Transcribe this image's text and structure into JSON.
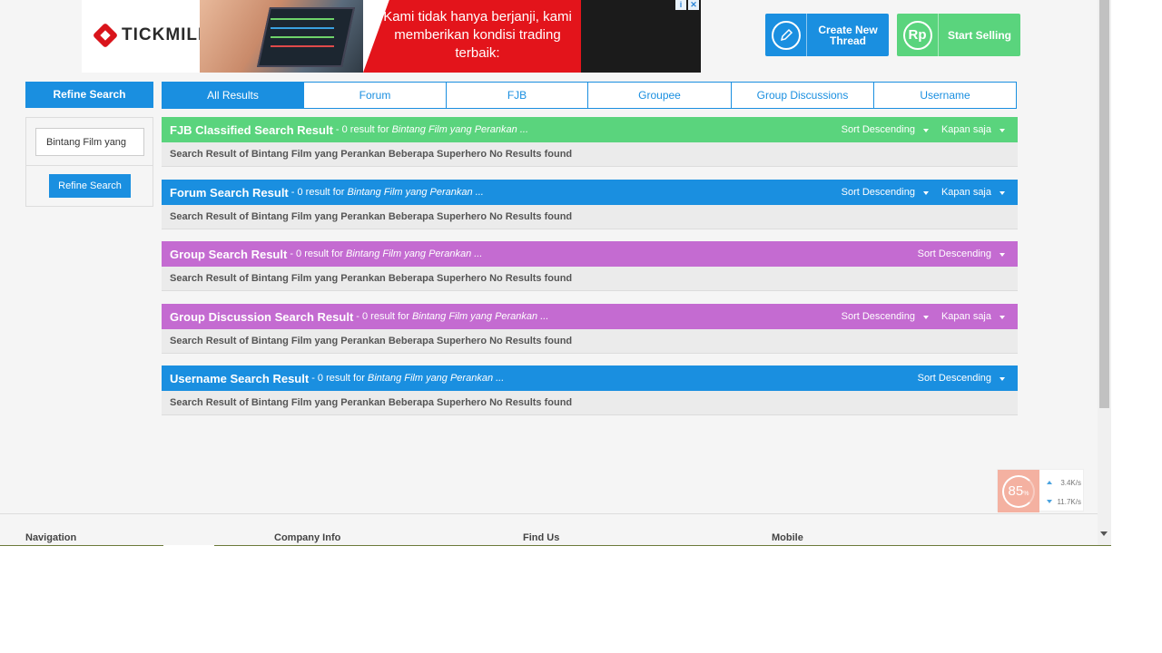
{
  "ad": {
    "brand": "TICKMILL",
    "copy": "Kami tidak hanya berjanji, kami memberikan kondisi trading terbaik:",
    "info_icon": "i",
    "close_icon": "✕"
  },
  "header": {
    "create_thread_label": "Create New Thread",
    "start_selling_label": "Start Selling",
    "start_selling_icon_text": "Rp"
  },
  "refine": {
    "title": "Refine Search",
    "query_value": "Bintang Film yang",
    "button_label": "Refine Search"
  },
  "tabs": [
    {
      "label": "All Results",
      "active": true
    },
    {
      "label": "Forum"
    },
    {
      "label": "FJB"
    },
    {
      "label": "Groupee"
    },
    {
      "label": "Group Discussions"
    },
    {
      "label": "Username"
    }
  ],
  "results": [
    {
      "title": "FJB Classified Search Result",
      "count": "- 0 result for",
      "query": "Bintang Film yang Perankan ...",
      "sort": "Sort Descending",
      "time": "Kapan saja",
      "body": "Search Result of Bintang Film yang Perankan Beberapa Superhero No Results found",
      "color": "#5ad47d"
    },
    {
      "title": "Forum Search Result",
      "count": "- 0 result for",
      "query": "Bintang Film yang Perankan ...",
      "sort": "Sort Descending",
      "time": "Kapan saja",
      "body": "Search Result of Bintang Film yang Perankan Beberapa Superhero No Results found",
      "color": "#1a8fe0"
    },
    {
      "title": "Group Search Result",
      "count": "- 0 result for",
      "query": "Bintang Film yang Perankan ...",
      "sort": "Sort Descending",
      "body": "Search Result of Bintang Film yang Perankan Beberapa Superhero No Results found",
      "color": "#c46bd1"
    },
    {
      "title": "Group Discussion Search Result",
      "count": "- 0 result for",
      "query": "Bintang Film yang Perankan ...",
      "sort": "Sort Descending",
      "time": "Kapan saja",
      "body": "Search Result of Bintang Film yang Perankan Beberapa Superhero No Results found",
      "color": "#c46bd1"
    },
    {
      "title": "Username Search Result",
      "count": "- 0 result for",
      "query": "Bintang Film yang Perankan ...",
      "sort": "Sort Descending",
      "body": "Search Result of Bintang Film yang Perankan Beberapa Superhero No Results found",
      "color": "#1a8fe0"
    }
  ],
  "speed_widget": {
    "percent": "85",
    "percent_unit": "%",
    "upload": "3.4K/s",
    "download": "11.7K/s"
  },
  "footer": {
    "navigation": "Navigation",
    "company_info": "Company Info",
    "find_us": "Find Us",
    "mobile": "Mobile"
  }
}
